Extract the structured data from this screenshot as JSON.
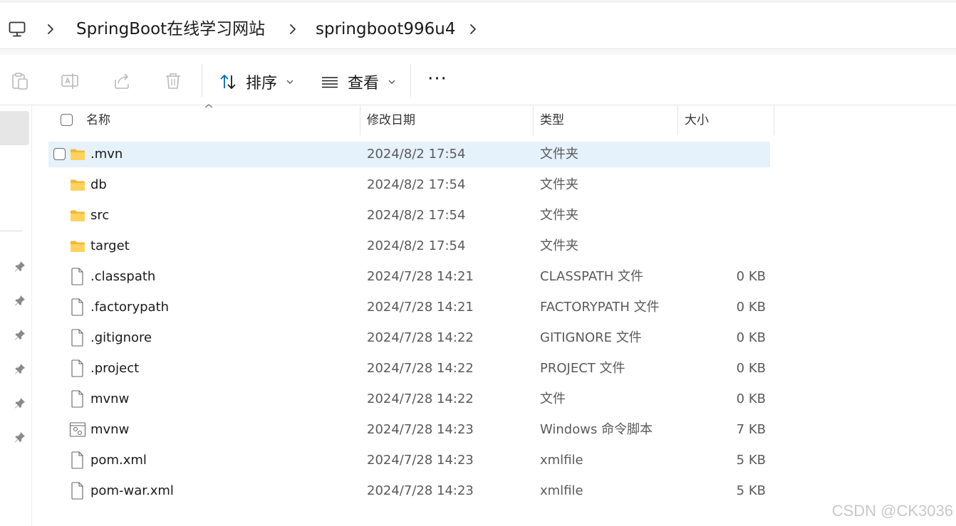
{
  "breadcrumb": {
    "items": [
      "SpringBoot在线学习网站",
      "springboot996u4"
    ]
  },
  "toolbar": {
    "sort_label": "排序",
    "view_label": "查看",
    "more_label": "···"
  },
  "columns": {
    "name": "名称",
    "modified": "修改日期",
    "type": "类型",
    "size": "大小"
  },
  "files": [
    {
      "name": ".mvn",
      "date": "2024/8/2 17:54",
      "type": "文件夹",
      "size": "",
      "icon": "folder-icon"
    },
    {
      "name": "db",
      "date": "2024/8/2 17:54",
      "type": "文件夹",
      "size": "",
      "icon": "folder-icon"
    },
    {
      "name": "src",
      "date": "2024/8/2 17:54",
      "type": "文件夹",
      "size": "",
      "icon": "folder-icon"
    },
    {
      "name": "target",
      "date": "2024/8/2 17:54",
      "type": "文件夹",
      "size": "",
      "icon": "folder-icon"
    },
    {
      "name": ".classpath",
      "date": "2024/7/28 14:21",
      "type": "CLASSPATH 文件",
      "size": "0 KB",
      "icon": "file-icon"
    },
    {
      "name": ".factorypath",
      "date": "2024/7/28 14:21",
      "type": "FACTORYPATH 文件",
      "size": "0 KB",
      "icon": "file-icon"
    },
    {
      "name": ".gitignore",
      "date": "2024/7/28 14:22",
      "type": "GITIGNORE 文件",
      "size": "0 KB",
      "icon": "file-icon"
    },
    {
      "name": ".project",
      "date": "2024/7/28 14:22",
      "type": "PROJECT 文件",
      "size": "0 KB",
      "icon": "file-icon"
    },
    {
      "name": "mvnw",
      "date": "2024/7/28 14:22",
      "type": "文件",
      "size": "0 KB",
      "icon": "file-icon"
    },
    {
      "name": "mvnw",
      "date": "2024/7/28 14:23",
      "type": "Windows 命令脚本",
      "size": "7 KB",
      "icon": "script-file-icon"
    },
    {
      "name": "pom.xml",
      "date": "2024/7/28 14:23",
      "type": "xmlfile",
      "size": "5 KB",
      "icon": "file-icon"
    },
    {
      "name": "pom-war.xml",
      "date": "2024/7/28 14:23",
      "type": "xmlfile",
      "size": "5 KB",
      "icon": "file-icon"
    }
  ],
  "selected_row": 0,
  "watermark": "CSDN @CK3036",
  "colors": {
    "selection": "#e5f1fb",
    "folder": "#f7c948",
    "accent": "#0067c0"
  }
}
